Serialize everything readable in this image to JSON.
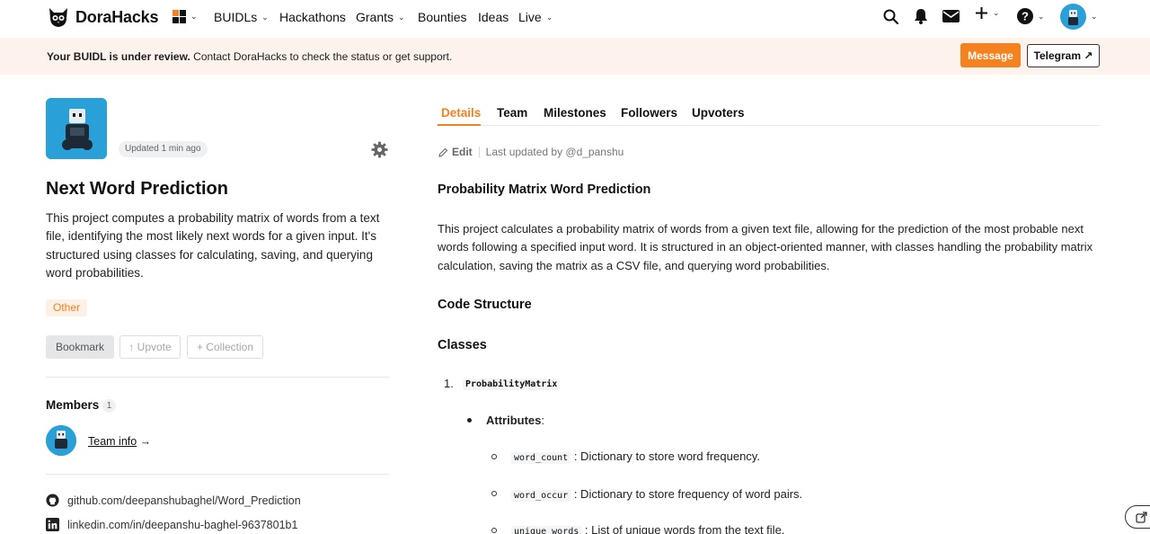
{
  "nav": {
    "brand": "DoraHacks",
    "items": [
      {
        "label": "BUIDLs",
        "has_dropdown": true
      },
      {
        "label": "Hackathons",
        "has_dropdown": false
      },
      {
        "label": "Grants",
        "has_dropdown": true
      },
      {
        "label": "Bounties",
        "has_dropdown": false
      },
      {
        "label": "Ideas",
        "has_dropdown": false
      },
      {
        "label": "Live",
        "has_dropdown": true
      }
    ],
    "icons": [
      "apps-grid-icon",
      "search-icon",
      "bell-icon",
      "mail-icon",
      "plus-icon",
      "help-icon",
      "user-avatar"
    ]
  },
  "banner": {
    "bold": "Your BUIDL is under review.",
    "text": " Contact DoraHacks to check the status or get support.",
    "message_button": "Message",
    "telegram_button": "Telegram ↗"
  },
  "project": {
    "updated": "Updated 1 min ago",
    "title": "Next Word Prediction",
    "description": "This project computes a probability matrix of words from a text file, identifying the most likely next words for a given input. It's structured using classes for calculating, saving, and querying word probabilities.",
    "tag": "Other",
    "bookmark": "Bookmark",
    "upvote": "↑ Upvote",
    "collection": "+ Collection"
  },
  "members": {
    "label": "Members",
    "count": "1",
    "team_info": "Team info",
    "arrow": " →"
  },
  "links": {
    "github": "github.com/deepanshubaghel/Word_Prediction",
    "linkedin": "linkedin.com/in/deepanshu-baghel-9637801b1"
  },
  "tabs": [
    "Details",
    "Team",
    "Milestones",
    "Followers",
    "Upvoters"
  ],
  "details": {
    "edit": "Edit",
    "last_updated": "Last updated by @d_panshu",
    "heading": "Probability Matrix Word Prediction",
    "paragraph": "This project calculates a probability matrix of words from a given text file, allowing for the prediction of the most probable next words following a specified input word. It is structured in an object-oriented manner, with classes handling the probability matrix calculation, saving the matrix as a CSV file, and querying word probabilities.",
    "code_structure": "Code Structure",
    "classes": "Classes",
    "list_number": "1.",
    "class_name": "ProbabilityMatrix",
    "attributes_label": "Attributes",
    "attributes_colon": ":",
    "attributes": [
      {
        "code": "word_count",
        "text": " : Dictionary to store word frequency."
      },
      {
        "code": "word_occur",
        "text": " : Dictionary to store frequency of word pairs."
      },
      {
        "code": "unique_words",
        "text": " : List of unique words from the text file."
      }
    ]
  },
  "colors": {
    "accent": "#f58220",
    "banner_bg": "#fdf3ec",
    "avatar_bg": "#2aa0d8"
  }
}
